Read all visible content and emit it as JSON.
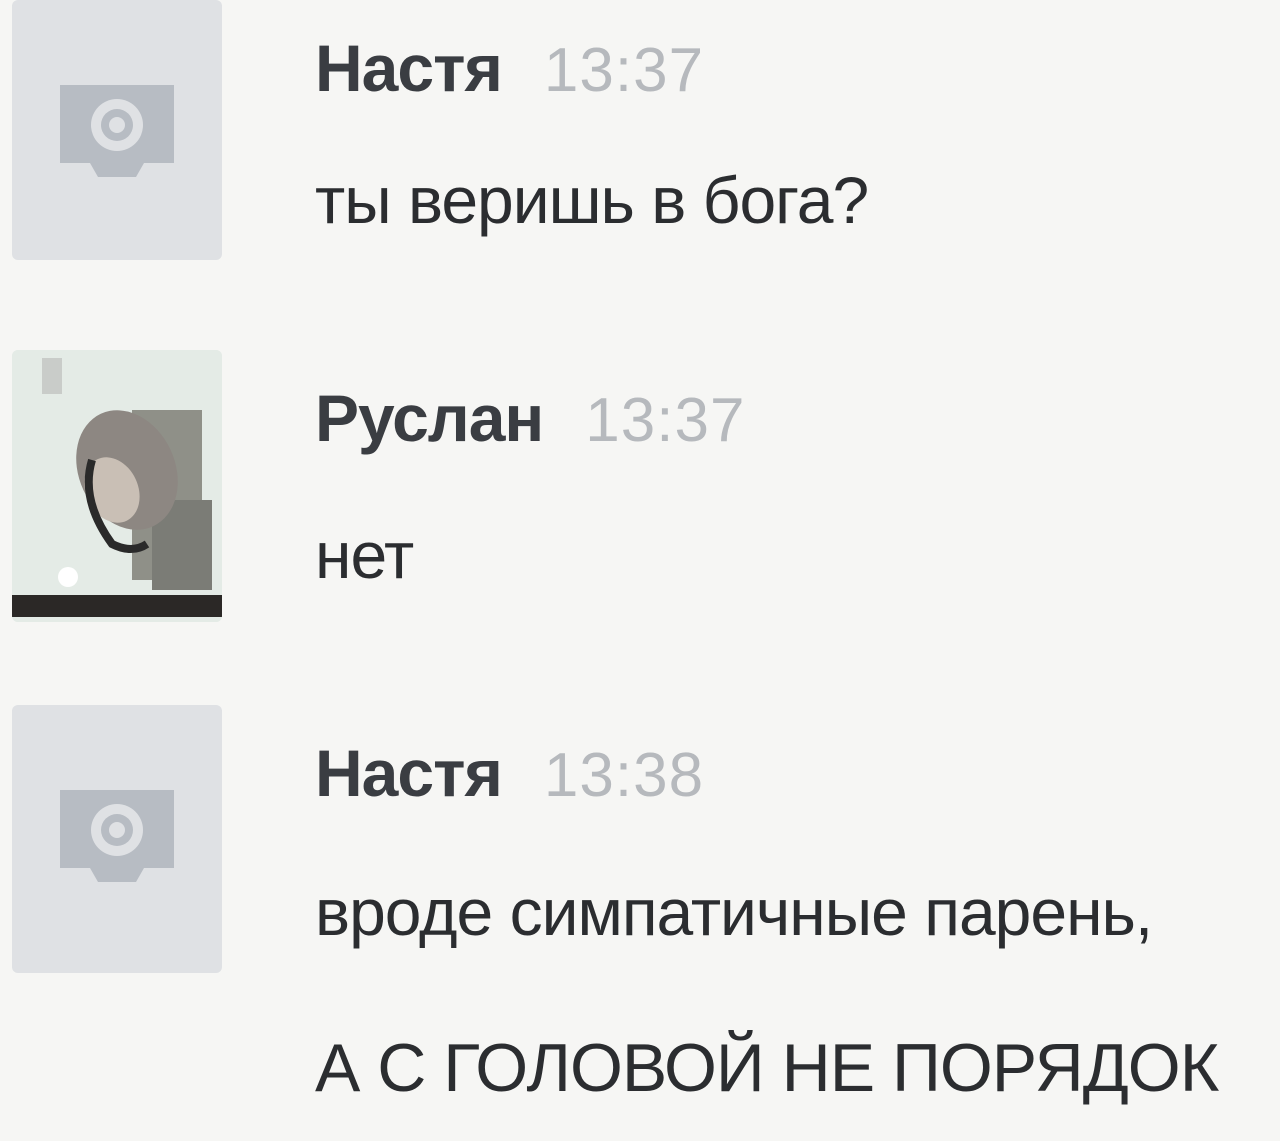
{
  "messages": [
    {
      "author": "Настя",
      "time": "13:37",
      "text": "ты веришь в бога?",
      "avatar": "camera-placeholder-icon"
    },
    {
      "author": "Руслан",
      "time": "13:37",
      "text": "нет",
      "avatar": "user-photo"
    },
    {
      "author": "Настя",
      "time": "13:38",
      "text_lines": [
        "вроде симпатичные парень,",
        "А С ГОЛОВОЙ НЕ ПОРЯДОК"
      ],
      "avatar": "camera-placeholder-icon"
    }
  ],
  "colors": {
    "background": "#f6f6f4",
    "author": "#3a3d42",
    "timestamp": "#b6b9bd",
    "text": "#2b2d30",
    "placeholder": "#dfe1e4"
  }
}
